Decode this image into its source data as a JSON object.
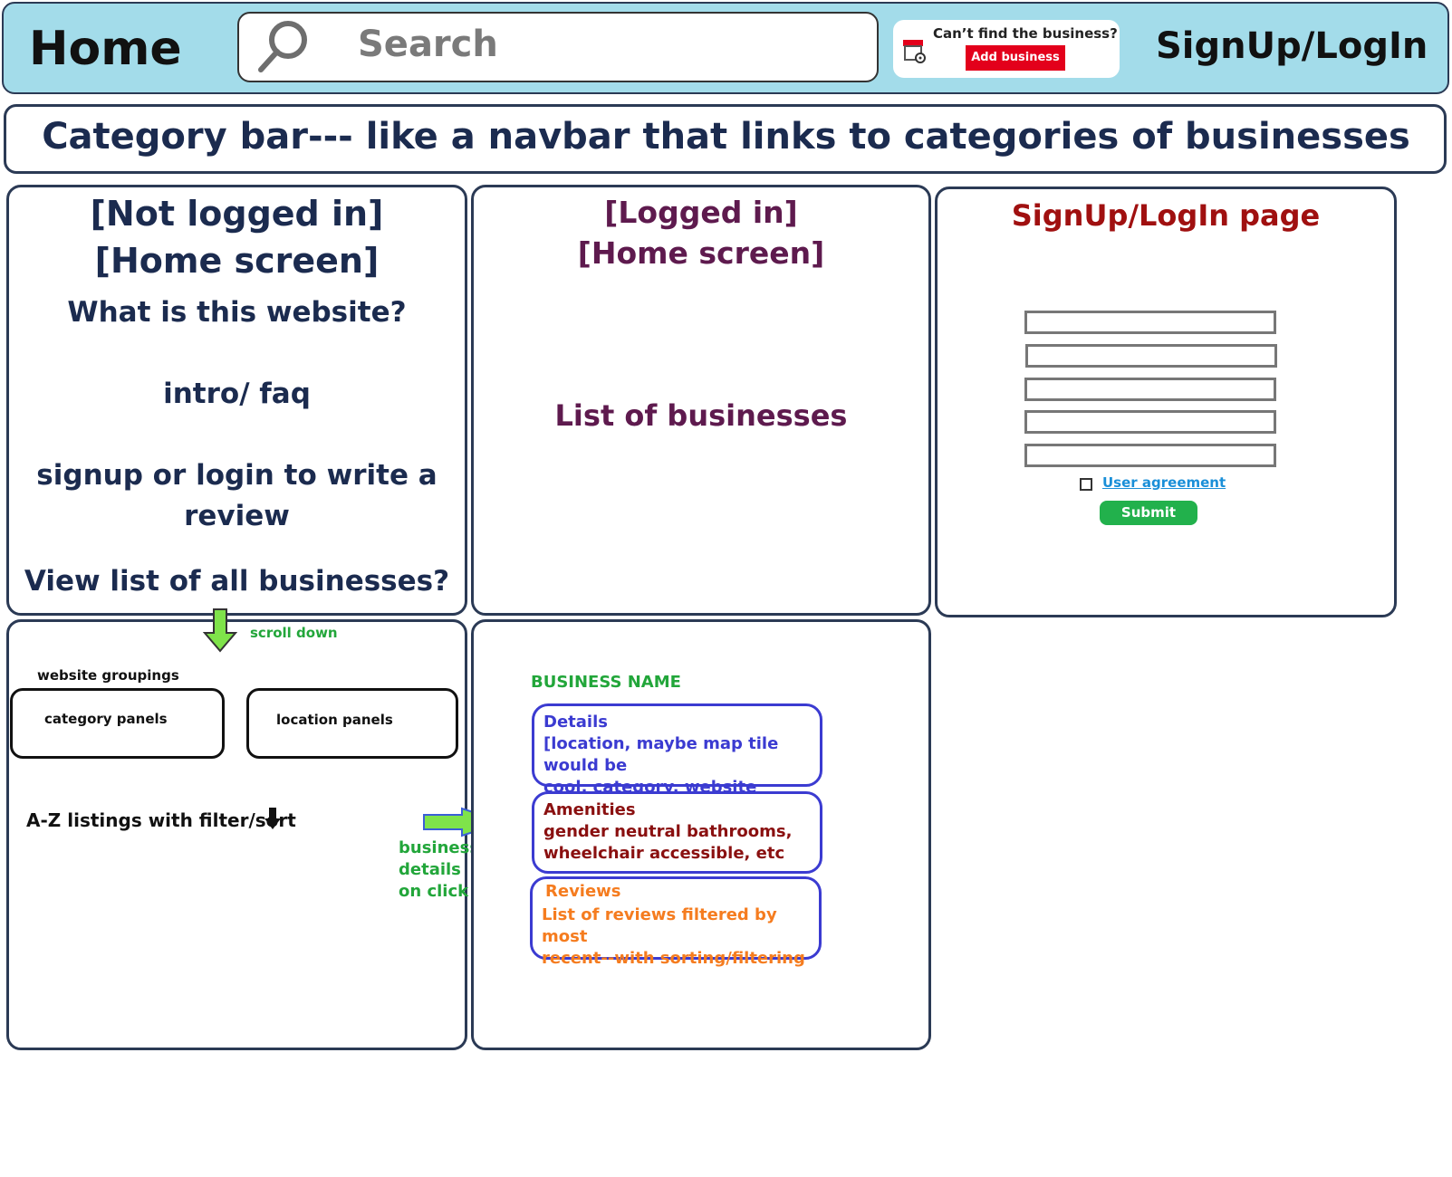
{
  "header": {
    "home_label": "Home",
    "search_placeholder": "Search",
    "add_business_question": "Can’t find the business?",
    "add_business_button": "Add business",
    "signup_label": "SignUp/LogIn"
  },
  "category_bar": {
    "text": "Category bar--- like a navbar that links to categories of businesses"
  },
  "panel_not_logged_in": {
    "line1": "[Not logged in]",
    "line2": "[Home screen]",
    "question": "What is this website?",
    "intro": "intro/ faq",
    "signup_prompt_line1": "signup or login to write a",
    "signup_prompt_line2": "review",
    "view_list": "View list of all businesses?"
  },
  "panel_logged_in": {
    "line1": "[Logged in]",
    "line2": "[Home screen]",
    "list": "List of businesses"
  },
  "panel_signup": {
    "title": "SignUp/LogIn page",
    "fields": [
      "",
      "",
      "",
      "",
      ""
    ],
    "agreement_link": "User agreement",
    "submit_button": "Submit"
  },
  "annotations": {
    "scroll_down": "scroll down",
    "business_details_line1": "business",
    "business_details_line2": "details",
    "business_details_line3": "on click"
  },
  "panel_scrolled": {
    "groupings_label": "website groupings",
    "category_panels": "category panels",
    "location_panels": "location panels",
    "az_listings": "A-Z listings with filter/sort"
  },
  "panel_business": {
    "business_name": "BUSINESS NAME",
    "details": {
      "title": "Details",
      "line1": "[location, maybe map tile would be",
      "line2": "cool, category, website"
    },
    "amenities": {
      "title": "Amenities",
      "line1": "gender neutral bathrooms,",
      "line2": "wheelchair accessible, etc"
    },
    "reviews": {
      "title": "Reviews",
      "line1": "List of reviews filtered by most",
      "line2": "recent--with sorting/filtering"
    }
  },
  "colors": {
    "header_bg": "#a3dcea",
    "navy_text": "#1b2b4f",
    "plum_text": "#5e1a4e",
    "signup_title": "#a01010",
    "details_blue": "#3b3bd1",
    "amenities_red": "#8a1010",
    "reviews_orange": "#f57c1f",
    "annotation_green": "#22a63a",
    "arrow_green": "#7fe34a"
  }
}
